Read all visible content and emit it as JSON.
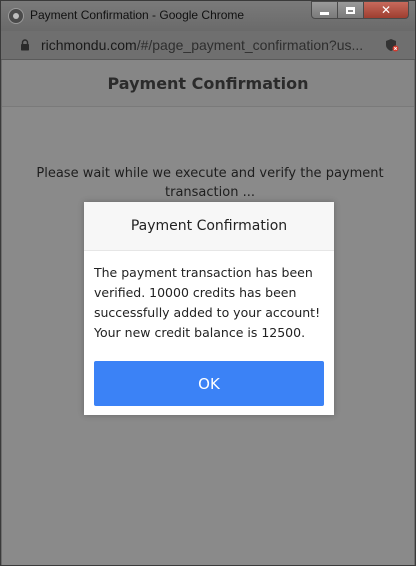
{
  "window": {
    "title": "Payment Confirmation - Google Chrome",
    "minimize_icon": "minimize-icon",
    "maximize_icon": "maximize-icon",
    "close_glyph": "✕"
  },
  "address_bar": {
    "domain": "richmondu.com",
    "path": "/#/page_payment_confirmation?us..."
  },
  "page": {
    "header_title": "Payment Confirmation",
    "wait_message": "Please wait while we execute and verify the payment transaction ..."
  },
  "modal": {
    "title": "Payment Confirmation",
    "message": "The payment transaction has been verified. 10000 credits has been successfully added to your account! Your new credit balance is 12500.",
    "ok_label": "OK"
  },
  "colors": {
    "ok_button": "#3b82f6",
    "overlay": "#8a8a8a"
  }
}
